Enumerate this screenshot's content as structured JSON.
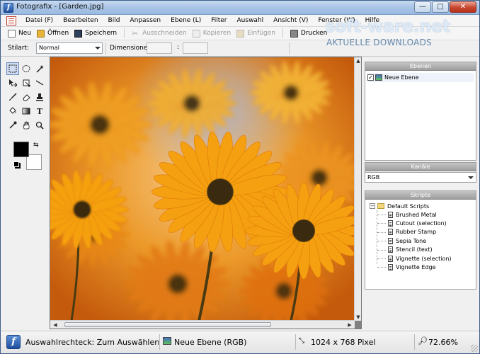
{
  "window": {
    "title": "Fotografix - [Garden.jpg]",
    "buttons": {
      "minimize": "—",
      "maximize": "□",
      "close": "✕"
    }
  },
  "menu": {
    "items": [
      "Datei (F)",
      "Bearbeiten",
      "Bild",
      "Anpassen",
      "Ebene (L)",
      "Filter",
      "Auswahl",
      "Ansicht (V)",
      "Fenster (W)",
      "Hilfe"
    ]
  },
  "toolbar": {
    "new": "Neu",
    "open": "Öffnen",
    "save": "Speichern",
    "cut": "Ausschneiden",
    "copy": "Kopieren",
    "paste": "Einfügen",
    "print": "Drucken"
  },
  "options": {
    "style_label": "Stilart:",
    "style_value": "Normal",
    "dimensions_label": "Dimensionen",
    "dim_separator": ":",
    "width_value": "",
    "height_value": ""
  },
  "tools": {
    "icons": [
      "rect-select-icon",
      "ellipse-select-icon",
      "magic-wand-icon",
      "move-icon",
      "crop-icon",
      "line-icon",
      "brush-icon",
      "eraser-icon",
      "clone-stamp-icon",
      "fill-bucket-icon",
      "gradient-icon",
      "text-icon",
      "eyedropper-icon",
      "hand-icon",
      "zoom-icon"
    ],
    "foreground_color": "#000000",
    "background_color": "#ffffff"
  },
  "panels": {
    "layers": {
      "title": "Ebenen",
      "items": [
        {
          "name": "Neue Ebene",
          "visible": "✓"
        }
      ]
    },
    "channels": {
      "title": "Kanäle",
      "selected": "RGB"
    },
    "scripts": {
      "title": "Skripte",
      "folder": "Default Scripts",
      "toggle": "−",
      "items": [
        "Brushed Metal",
        "Cutout (selection)",
        "Rubber Stamp",
        "Sepia Tone",
        "Stencil (text)",
        "Vignette (selection)",
        "Vignette Edge"
      ]
    }
  },
  "status": {
    "hint": "Auswahlrechteck: Zum Auswählen inne",
    "layer": "Neue Ebene (RGB)",
    "size": "1024 x 768 Pixel",
    "zoom": "72.66%"
  },
  "watermark": {
    "main": "soft-ware.net",
    "sub": "AKTUELLE DOWNLOADS"
  },
  "colors": {
    "accent": "#1f4f9f",
    "panel_header": "#9e9e9e",
    "flower_petal": "#f5a010",
    "flower_center": "#3a2a10"
  }
}
